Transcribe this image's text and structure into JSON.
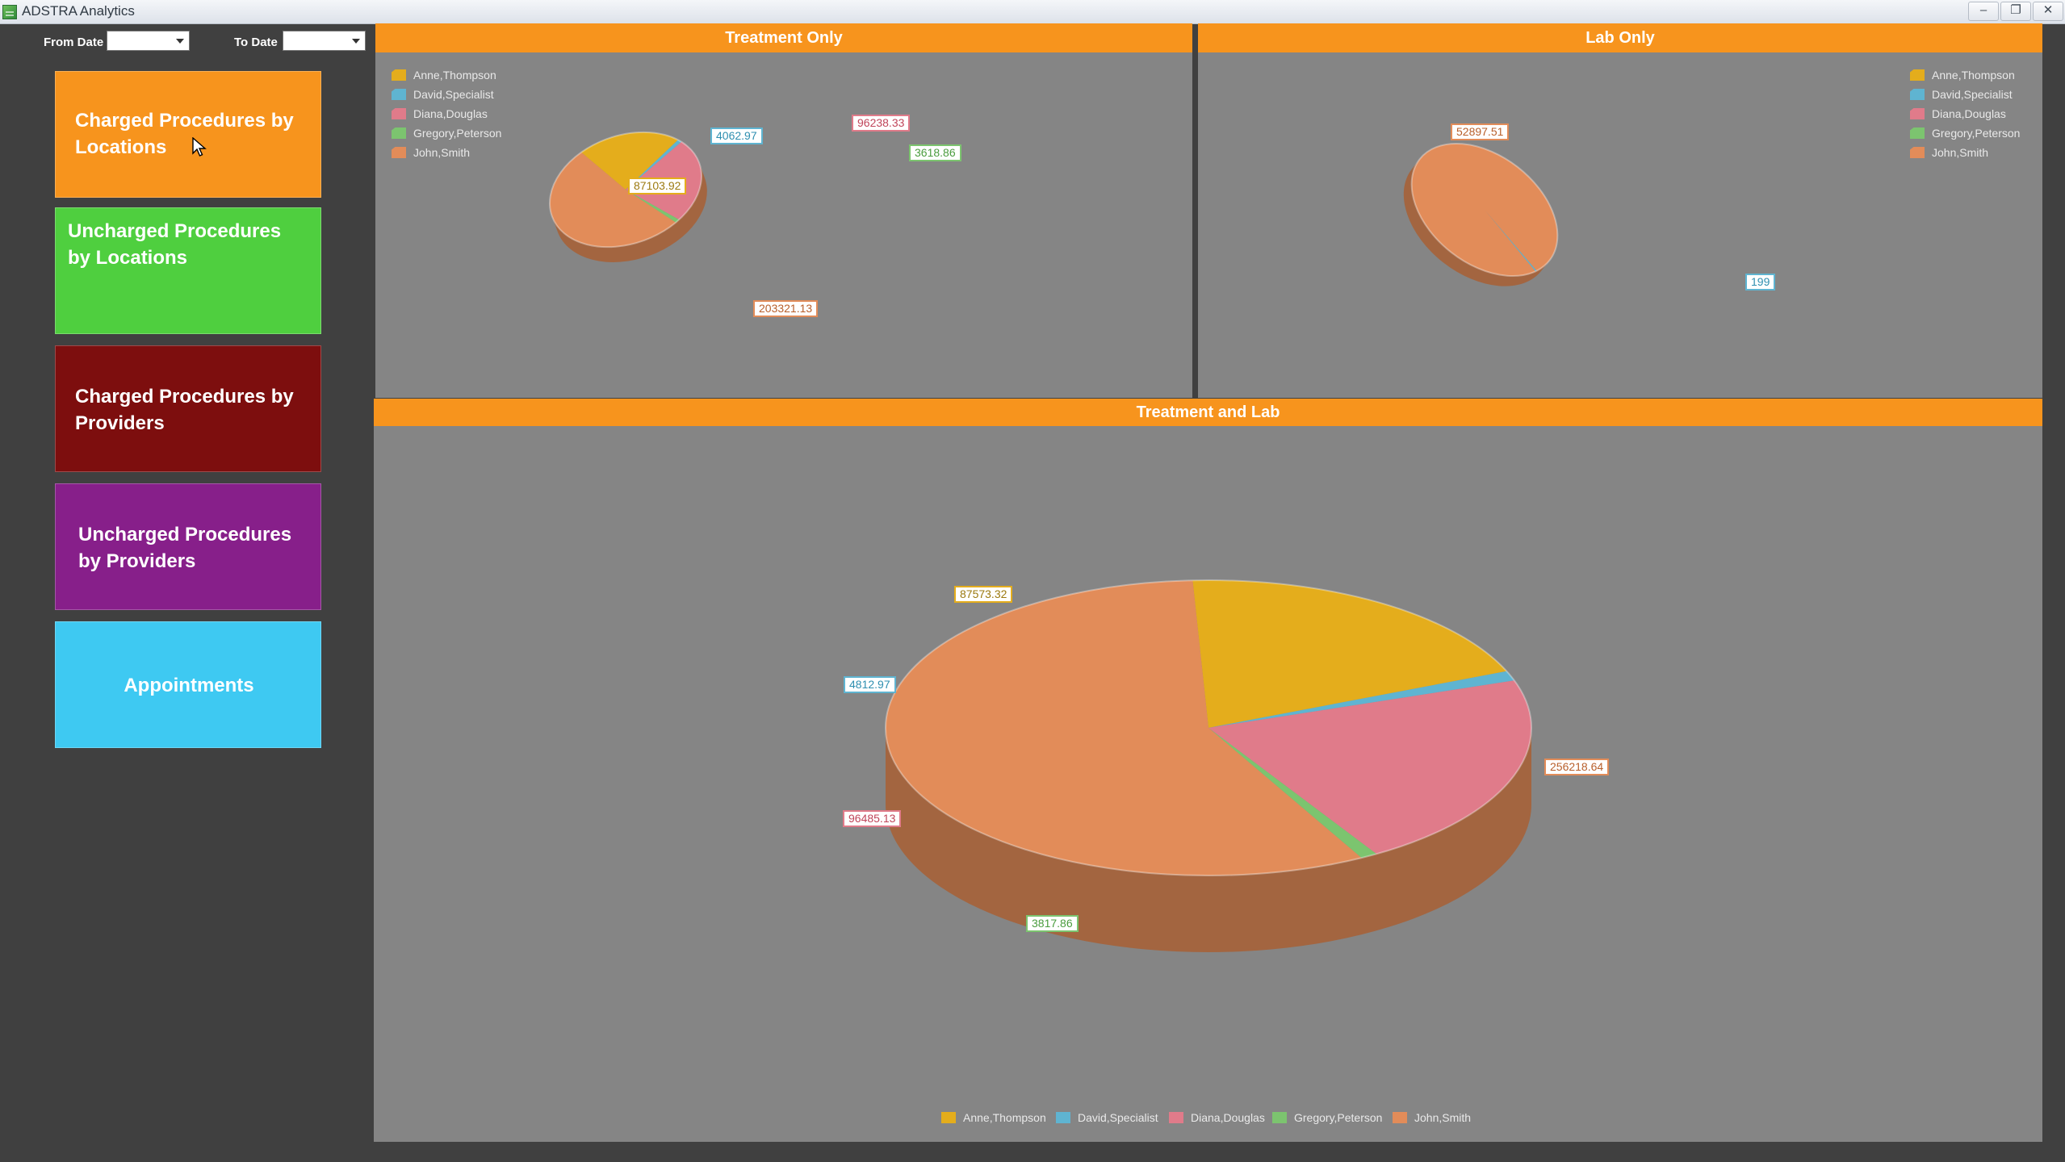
{
  "window": {
    "title": "ADSTRA Analytics",
    "controls": [
      "–",
      "❐",
      "✕"
    ]
  },
  "filters": {
    "from_label": "From Date",
    "from_value": "",
    "to_label": "To Date",
    "to_value": ""
  },
  "nav": [
    {
      "label_lines": [
        "Charged Procedures by",
        "Locations"
      ],
      "color": "#f7941d"
    },
    {
      "label_lines": [
        "Uncharged Procedures",
        "by Locations"
      ],
      "color": "#4fcf3f"
    },
    {
      "label_lines": [
        "Charged Procedures by",
        "Providers"
      ],
      "color": "#7d0e0e"
    },
    {
      "label_lines": [
        "Uncharged Procedures",
        "by Providers"
      ],
      "color": "#871f8a"
    },
    {
      "label_lines": [
        "Appointments"
      ],
      "color": "#3ec9f2"
    }
  ],
  "colors": {
    "Anne,Thompson": "#e4ad1c",
    "David,Specialist": "#5fb4d1",
    "Diana,Douglas": "#e07b8a",
    "Gregory,Peterson": "#7cc46f",
    "John,Smith": "#e28c59"
  },
  "chart_data": [
    {
      "type": "pie",
      "title": "Treatment Only",
      "labels": [
        "Anne,Thompson",
        "David,Specialist",
        "Diana,Douglas",
        "Gregory,Peterson",
        "John,Smith"
      ],
      "values": [
        87103.92,
        4062.97,
        96238.33,
        3618.86,
        203321.13
      ],
      "value_labels": [
        "87103.92",
        "4062.97",
        "96238.33",
        "3618.86",
        "203321.13"
      ],
      "legend_position": "top-left"
    },
    {
      "type": "pie",
      "title": "Lab Only",
      "labels": [
        "Anne,Thompson",
        "David,Specialist",
        "Diana,Douglas",
        "Gregory,Peterson",
        "John,Smith"
      ],
      "values": [
        null,
        199,
        null,
        null,
        52897.51
      ],
      "value_labels": [
        "",
        "199",
        "",
        "",
        "52897.51"
      ],
      "legend_position": "top-right"
    },
    {
      "type": "pie",
      "title": "Treatment and Lab",
      "labels": [
        "Anne,Thompson",
        "David,Specialist",
        "Diana,Douglas",
        "Gregory,Peterson",
        "John,Smith"
      ],
      "values": [
        87573.32,
        4812.97,
        96485.13,
        3817.86,
        256218.64
      ],
      "value_labels": [
        "87573.32",
        "4812.97",
        "96485.13",
        "3817.86",
        "256218.64"
      ],
      "legend_position": "bottom"
    }
  ]
}
